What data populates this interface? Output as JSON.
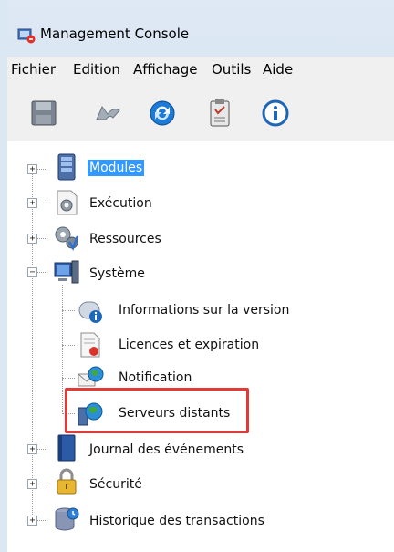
{
  "window": {
    "title": "Management Console",
    "icon": "console-app-icon"
  },
  "menu": [
    "Fichier",
    "Edition",
    "Affichage",
    "Outils",
    "Aide"
  ],
  "toolbar": [
    {
      "name": "save-icon",
      "color": "#7a8591"
    },
    {
      "name": "undo-icon",
      "color": "#8f9aa5"
    },
    {
      "name": "refresh-icon",
      "color": "#1d7bd8"
    },
    {
      "name": "clipboard-icon",
      "color": "#6b6b6b"
    },
    {
      "name": "info-icon",
      "color": "#1e67b8"
    }
  ],
  "tree": {
    "modules": {
      "label": "Modules",
      "expander": "+",
      "icon": "server-icon",
      "selected": true
    },
    "execution": {
      "label": "Exécution",
      "expander": "+",
      "icon": "gear-document-icon"
    },
    "ressources": {
      "label": "Ressources",
      "expander": "+",
      "icon": "gears-icon"
    },
    "systeme": {
      "label": "Système",
      "expander": "−",
      "icon": "computer-icon",
      "children": {
        "version": {
          "label": "Informations sur la version",
          "icon": "info-badge-icon"
        },
        "licences": {
          "label": "Licences et expiration",
          "icon": "certificate-icon"
        },
        "notification": {
          "label": "Notification",
          "icon": "envelope-globe-icon"
        },
        "serveurs": {
          "label": "Serveurs distants",
          "icon": "server-globe-icon",
          "highlighted": true
        }
      }
    },
    "journal": {
      "label": "Journal des événements",
      "expander": "+",
      "icon": "book-icon"
    },
    "securite": {
      "label": "Sécurité",
      "expander": "+",
      "icon": "padlock-icon"
    },
    "historique": {
      "label": "Historique des transactions",
      "expander": "+",
      "icon": "database-history-icon"
    }
  },
  "highlight_color": "#e53935"
}
